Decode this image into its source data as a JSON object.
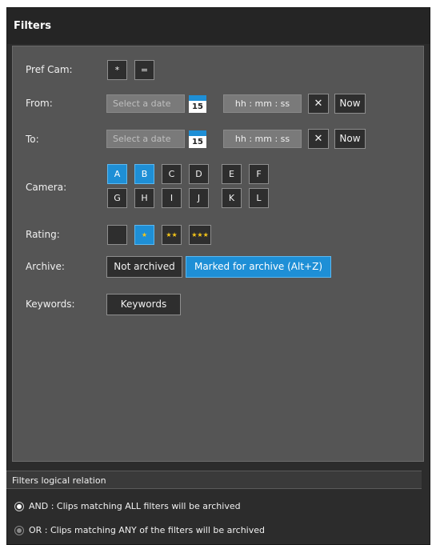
{
  "title": "Filters",
  "pref_cam": {
    "label": "Pref Cam:",
    "buttons": [
      "*",
      "="
    ]
  },
  "from": {
    "label": "From:",
    "date_placeholder": "Select a date",
    "calendar_day": "15",
    "time_placeholder": "hh : mm : ss",
    "clear": "✕",
    "now": "Now"
  },
  "to": {
    "label": "To:",
    "date_placeholder": "Select a date",
    "calendar_day": "15",
    "time_placeholder": "hh : mm : ss",
    "clear": "✕",
    "now": "Now"
  },
  "camera": {
    "label": "Camera:",
    "row1": [
      "A",
      "B",
      "C",
      "D",
      "E",
      "F"
    ],
    "row2": [
      "G",
      "H",
      "I",
      "J",
      "K",
      "L"
    ],
    "selected": [
      "A",
      "B"
    ]
  },
  "rating": {
    "label": "Rating:",
    "options": [
      "",
      "★",
      "★★",
      "★★★"
    ],
    "selected_index": 1
  },
  "archive": {
    "label": "Archive:",
    "not_archived": "Not archived",
    "marked": "Marked for archive (Alt+Z)"
  },
  "keywords": {
    "label": "Keywords:",
    "button": "Keywords"
  },
  "logical_relation": {
    "header": "Filters logical relation",
    "and_option": "AND : Clips matching ALL filters will be archived",
    "or_option": "OR : Clips matching ANY of the filters will be archived"
  },
  "colors": {
    "accent": "#1e8fd6",
    "panel": "#555555",
    "frame": "#2c2c2c"
  }
}
